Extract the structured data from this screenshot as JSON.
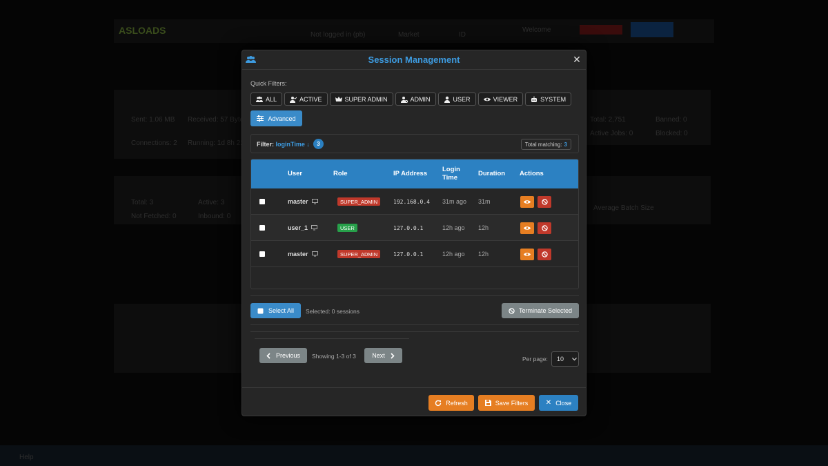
{
  "background": {
    "logo": "ASLOADS",
    "nav": [
      "Not logged in (pb)",
      "Market",
      "ID"
    ],
    "welcome": "Welcome",
    "left_cards": [
      "Sent: 1.06 MB",
      "Received: 57 Bytes",
      "Connections: 2",
      "Running: 1d 8h 21m 33s",
      "Total: 3",
      "Active: 3",
      "Not Fetched: 0",
      "Inbound: 0"
    ],
    "right_cards": [
      "Total: 2,751",
      "Banned: 0",
      "Active Jobs: 0",
      "Blocked: 0",
      "Average Batch Size"
    ],
    "footer_text": "Help"
  },
  "modal": {
    "title": "Session Management",
    "close_icon": "close-icon",
    "header_icon": "users-icon",
    "quick_filters_label": "Quick Filters:",
    "chips": [
      {
        "label": "ALL",
        "icon": "users-icon"
      },
      {
        "label": "ACTIVE",
        "icon": "user-check-icon"
      },
      {
        "label": "SUPER ADMIN",
        "icon": "crown-icon"
      },
      {
        "label": "ADMIN",
        "icon": "user-gear-icon"
      },
      {
        "label": "USER",
        "icon": "user-icon"
      },
      {
        "label": "VIEWER",
        "icon": "eye-icon"
      },
      {
        "label": "SYSTEM",
        "icon": "robot-icon"
      }
    ],
    "advanced_label": "Advanced",
    "filter": {
      "label": "Filter:",
      "value": "loginTime ↓",
      "count": "3",
      "total_label": "Total matching:",
      "total_value": "3"
    },
    "table": {
      "headers": [
        "User",
        "Role",
        "IP Address",
        "Login Time",
        "Duration",
        "Actions"
      ],
      "rows": [
        {
          "user": "master",
          "role": "SUPER_ADMIN",
          "ip": "192.168.0.4",
          "login": "31m ago",
          "duration": "31m"
        },
        {
          "user": "user_1",
          "role": "USER",
          "ip": "127.0.0.1",
          "login": "12h ago",
          "duration": "12h"
        },
        {
          "user": "master",
          "role": "SUPER_ADMIN",
          "ip": "127.0.0.1",
          "login": "12h ago",
          "duration": "12h"
        }
      ]
    },
    "select_all_label": "Select All",
    "selected_status": "Selected: 0 sessions",
    "terminate_label": "Terminate Selected",
    "pagination": {
      "previous_label": "Previous",
      "showing": "Showing 1-3 of 3",
      "next_label": "Next",
      "per_page_label": "Per page:",
      "per_page_value": "10"
    },
    "footer": {
      "refresh_label": "Refresh",
      "save_label": "Save Filters",
      "close_label": "Close"
    }
  },
  "colors": {
    "accent_blue": "#2c81c2",
    "super_admin": "#c0392b",
    "user": "#27a04a",
    "orange": "#e67e22",
    "danger": "#c0392b",
    "grey_button": "#7c8587"
  }
}
